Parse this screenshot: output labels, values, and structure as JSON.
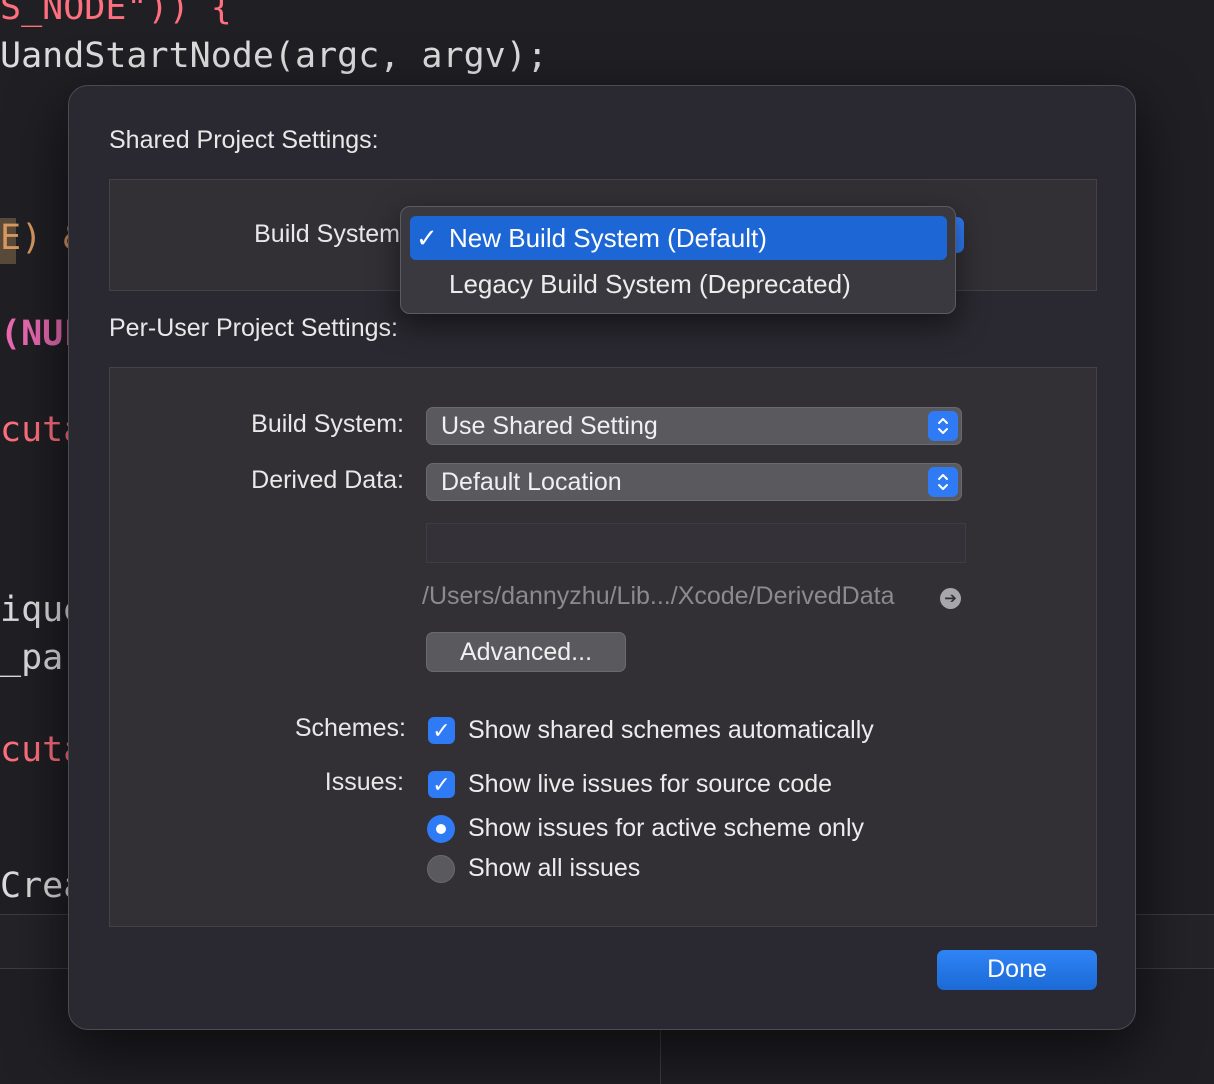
{
  "editor": {
    "lines": [
      {
        "text": "S_NODE\")) {",
        "style": "red"
      },
      {
        "text": "UandStartNode(argc, argv);",
        "style": "plain"
      },
      {
        "text": "E) &",
        "style": "orange"
      },
      {
        "text": "(NUL",
        "style": "pink"
      },
      {
        "text": "cuta",
        "style": "red"
      },
      {
        "text": "ique",
        "style": "plain"
      },
      {
        "text": "_pa",
        "style": "plain"
      },
      {
        "text": "cuta",
        "style": "red"
      },
      {
        "text": "Crea",
        "style": "plain"
      }
    ]
  },
  "dialog": {
    "shared_title": "Shared Project Settings:",
    "shared_build_system_label": "Build System",
    "menu": {
      "items": [
        {
          "label": "New Build System (Default)",
          "checked": true
        },
        {
          "label": "Legacy Build System (Deprecated)",
          "checked": false
        }
      ],
      "check_glyph": "✓"
    },
    "per_user_title": "Per-User Project Settings:",
    "build_system_label": "Build System:",
    "build_system_value": "Use Shared Setting",
    "derived_data_label": "Derived Data:",
    "derived_data_value": "Default Location",
    "derived_data_path": "/Users/dannyzhu/Lib.../Xcode/DerivedData",
    "advanced_button": "Advanced...",
    "schemes_label": "Schemes:",
    "schemes_option": "Show shared schemes automatically",
    "issues_label": "Issues:",
    "issues_option_live": "Show live issues for source code",
    "issues_radio_active": "Show issues for active scheme only",
    "issues_radio_all": "Show all issues",
    "done_button": "Done"
  },
  "colors": {
    "accent": "#2f7af5",
    "menu_highlight": "#1c66d6"
  }
}
